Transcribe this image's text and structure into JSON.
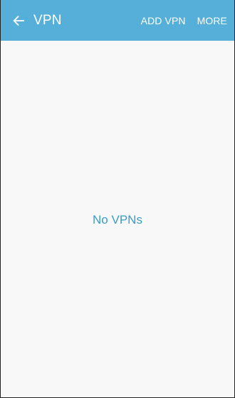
{
  "app_bar": {
    "title": "VPN",
    "back_icon": "arrow-left-icon",
    "actions": {
      "add_vpn_label": "ADD VPN",
      "more_label": "MORE"
    },
    "background_color": "#56afd8"
  },
  "content": {
    "empty_state_text": "No VPNs",
    "empty_state_color": "#3b9cc7"
  }
}
